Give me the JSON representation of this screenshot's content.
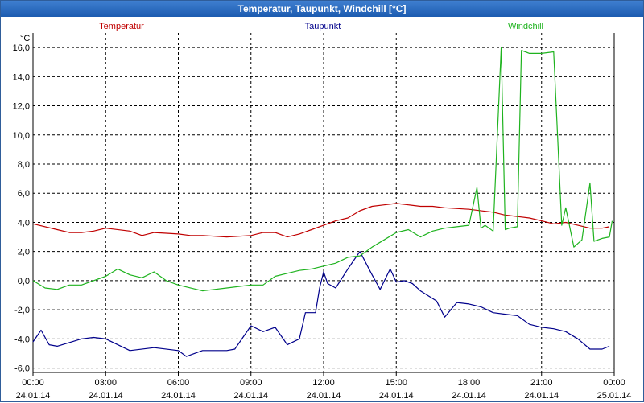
{
  "window": {
    "title": "Temperatur, Taupunkt, Windchill [°C]"
  },
  "chart_data": {
    "type": "line",
    "title": "Temperatur, Taupunkt, Windchill [°C]",
    "ylabel": "°C",
    "ylim": [
      -6.3,
      17.0
    ],
    "yticks": [
      16,
      14,
      12,
      10,
      8,
      6,
      4,
      2,
      0,
      -2,
      -4,
      -6
    ],
    "ytick_labels": [
      "16,0",
      "14,0",
      "12,0",
      "10,0",
      "8,0",
      "6,0",
      "4,0",
      "2,0",
      "0,0",
      "-2,0",
      "-4,0",
      "-6,0"
    ],
    "xlim": [
      "24.01.14 00:00",
      "25.01.14 00:00"
    ],
    "xticks_hours": [
      0,
      3,
      6,
      9,
      12,
      15,
      18,
      21,
      24
    ],
    "xtick_times": [
      "00:00",
      "03:00",
      "06:00",
      "09:00",
      "12:00",
      "15:00",
      "18:00",
      "21:00",
      "00:00"
    ],
    "xtick_dates": [
      "24.01.14",
      "24.01.14",
      "24.01.14",
      "24.01.14",
      "24.01.14",
      "24.01.14",
      "24.01.14",
      "24.01.14",
      "25.01.14"
    ],
    "grid": true,
    "legend_position": "top",
    "series": [
      {
        "name": "Temperatur",
        "color": "#c00000",
        "x": [
          "24.01.14 00:00",
          "24.01.14 01:00",
          "24.01.14 01:30",
          "24.01.14 02:00",
          "24.01.14 02:30",
          "24.01.14 03:00",
          "24.01.14 04:00",
          "24.01.14 04:30",
          "24.01.14 05:00",
          "24.01.14 06:00",
          "24.01.14 06:30",
          "24.01.14 07:00",
          "24.01.14 08:00",
          "24.01.14 09:00",
          "24.01.14 09:30",
          "24.01.14 10:00",
          "24.01.14 10:30",
          "24.01.14 11:00",
          "24.01.14 11:30",
          "24.01.14 12:00",
          "24.01.14 12:30",
          "24.01.14 13:00",
          "24.01.14 13:30",
          "24.01.14 14:00",
          "24.01.14 14:30",
          "24.01.14 15:00",
          "24.01.14 15:30",
          "24.01.14 16:00",
          "24.01.14 16:30",
          "24.01.14 17:00",
          "24.01.14 18:00",
          "24.01.14 19:00",
          "24.01.14 19:30",
          "24.01.14 20:00",
          "24.01.14 20:30",
          "24.01.14 21:00",
          "24.01.14 21:30",
          "24.01.14 22:00",
          "24.01.14 22:30",
          "24.01.14 23:00",
          "24.01.14 23:30",
          "24.01.14 23:48"
        ],
        "values": [
          3.9,
          3.5,
          3.3,
          3.3,
          3.4,
          3.6,
          3.4,
          3.1,
          3.3,
          3.2,
          3.1,
          3.1,
          3.0,
          3.1,
          3.3,
          3.3,
          3.0,
          3.2,
          3.5,
          3.8,
          4.1,
          4.3,
          4.8,
          5.1,
          5.2,
          5.3,
          5.2,
          5.1,
          5.1,
          5.0,
          4.9,
          4.7,
          4.5,
          4.4,
          4.3,
          4.1,
          3.9,
          4.0,
          3.8,
          3.6,
          3.6,
          3.7
        ]
      },
      {
        "name": "Taupunkt",
        "color": "#00008b",
        "x": [
          "24.01.14 00:00",
          "24.01.14 00:20",
          "24.01.14 00:40",
          "24.01.14 01:00",
          "24.01.14 02:00",
          "24.01.14 02:30",
          "24.01.14 03:00",
          "24.01.14 04:00",
          "24.01.14 05:00",
          "24.01.14 06:00",
          "24.01.14 06:20",
          "24.01.14 07:00",
          "24.01.14 08:00",
          "24.01.14 08:20",
          "24.01.14 09:00",
          "24.01.14 09:30",
          "24.01.14 10:00",
          "24.01.14 10:30",
          "24.01.14 11:00",
          "24.01.14 11:15",
          "24.01.14 11:40",
          "24.01.14 11:50",
          "24.01.14 12:00",
          "24.01.14 12:10",
          "24.01.14 12:30",
          "24.01.14 13:00",
          "24.01.14 13:15",
          "24.01.14 13:30",
          "24.01.14 14:00",
          "24.01.14 14:20",
          "24.01.14 14:45",
          "24.01.14 15:00",
          "24.01.14 15:20",
          "24.01.14 15:40",
          "24.01.14 16:00",
          "24.01.14 16:40",
          "24.01.14 17:00",
          "24.01.14 17:30",
          "24.01.14 18:00",
          "24.01.14 18:30",
          "24.01.14 19:00",
          "24.01.14 19:30",
          "24.01.14 20:00",
          "24.01.14 20:30",
          "24.01.14 21:00",
          "24.01.14 21:30",
          "24.01.14 22:00",
          "24.01.14 22:30",
          "24.01.14 23:00",
          "24.01.14 23:30",
          "24.01.14 23:48"
        ],
        "values": [
          -4.2,
          -3.4,
          -4.4,
          -4.5,
          -4.0,
          -3.9,
          -4.0,
          -4.8,
          -4.6,
          -4.8,
          -5.2,
          -4.8,
          -4.8,
          -4.7,
          -3.1,
          -3.5,
          -3.2,
          -4.4,
          -4.0,
          -2.2,
          -2.2,
          -0.5,
          0.6,
          -0.2,
          -0.5,
          0.8,
          1.4,
          2.0,
          0.4,
          -0.6,
          0.8,
          -0.1,
          0.0,
          -0.2,
          -0.7,
          -1.4,
          -2.5,
          -1.5,
          -1.6,
          -1.8,
          -2.2,
          -2.3,
          -2.4,
          -3.0,
          -3.2,
          -3.3,
          -3.5,
          -4.0,
          -4.7,
          -4.7,
          -4.5
        ]
      },
      {
        "name": "Windchill",
        "color": "#1fb31f",
        "x": [
          "24.01.14 00:00",
          "24.01.14 00:30",
          "24.01.14 01:00",
          "24.01.14 01:30",
          "24.01.14 02:00",
          "24.01.14 03:00",
          "24.01.14 03:30",
          "24.01.14 04:00",
          "24.01.14 04:30",
          "24.01.14 05:00",
          "24.01.14 05:30",
          "24.01.14 06:00",
          "24.01.14 07:00",
          "24.01.14 08:00",
          "24.01.14 09:00",
          "24.01.14 09:30",
          "24.01.14 10:00",
          "24.01.14 10:30",
          "24.01.14 11:00",
          "24.01.14 11:30",
          "24.01.14 12:00",
          "24.01.14 12:30",
          "24.01.14 13:00",
          "24.01.14 13:30",
          "24.01.14 14:00",
          "24.01.14 14:30",
          "24.01.14 15:00",
          "24.01.14 15:30",
          "24.01.14 16:00",
          "24.01.14 16:30",
          "24.01.14 17:00",
          "24.01.14 17:30",
          "24.01.14 18:00",
          "24.01.14 18:20",
          "24.01.14 18:30",
          "24.01.14 18:40",
          "24.01.14 19:00",
          "24.01.14 19:20",
          "24.01.14 19:30",
          "24.01.14 19:40",
          "24.01.14 20:00",
          "24.01.14 20:10",
          "24.01.14 20:20",
          "24.01.14 20:30",
          "24.01.14 20:40",
          "24.01.14 21:00",
          "24.01.14 21:30",
          "24.01.14 21:50",
          "24.01.14 22:00",
          "24.01.14 22:20",
          "24.01.14 22:40",
          "24.01.14 23:00",
          "24.01.14 23:10",
          "24.01.14 23:20",
          "24.01.14 23:30",
          "24.01.14 23:48",
          "24.01.14 23:55"
        ],
        "values": [
          0.0,
          -0.5,
          -0.6,
          -0.3,
          -0.3,
          0.3,
          0.8,
          0.4,
          0.2,
          0.6,
          0.0,
          -0.3,
          -0.7,
          -0.5,
          -0.3,
          -0.3,
          0.3,
          0.5,
          0.7,
          0.8,
          1.0,
          1.2,
          1.6,
          1.7,
          2.3,
          2.8,
          3.3,
          3.5,
          3.0,
          3.4,
          3.6,
          3.7,
          3.8,
          6.4,
          3.6,
          3.8,
          3.4,
          16.0,
          3.5,
          3.6,
          3.7,
          15.8,
          15.7,
          15.6,
          15.6,
          15.6,
          15.7,
          3.8,
          5.0,
          2.3,
          2.8,
          6.7,
          2.7,
          2.8,
          2.9,
          3.0,
          4.1
        ]
      }
    ]
  }
}
